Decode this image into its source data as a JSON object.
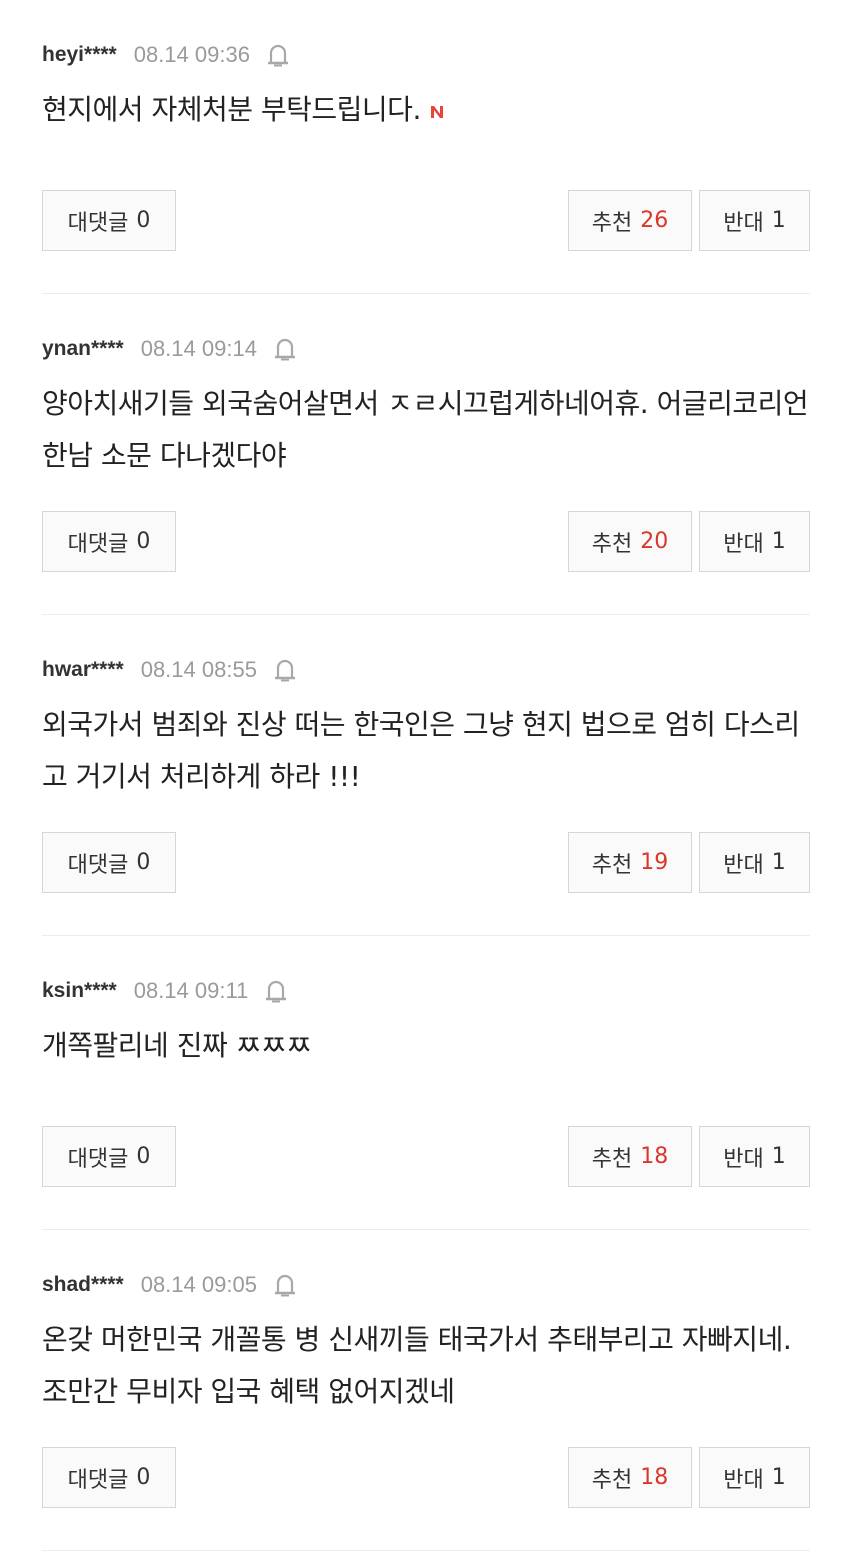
{
  "labels": {
    "reply": "대댓글",
    "recommend": "추천",
    "oppose": "반대"
  },
  "colors": {
    "accent_red": "#d9372b",
    "badge_red": "#e8443a"
  },
  "comments": [
    {
      "user": "heyi****",
      "time": "08.14 09:36",
      "text": "현지에서 자체처분 부탁드립니다.",
      "badge": "N",
      "reply_count": "0",
      "recommend": "26",
      "oppose": "1"
    },
    {
      "user": "ynan****",
      "time": "08.14 09:14",
      "text": "양아치새기들 외국숨어살면서 ㅈㄹ시끄럽게하네어휴. 어글리코리언한남 소문 다나겠다야",
      "reply_count": "0",
      "recommend": "20",
      "oppose": "1"
    },
    {
      "user": "hwar****",
      "time": "08.14 08:55",
      "text": "외국가서 범죄와 진상 떠는 한국인은 그냥 현지 법으로 엄히 다스리고 거기서 처리하게 하라 !!!",
      "reply_count": "0",
      "recommend": "19",
      "oppose": "1"
    },
    {
      "user": "ksin****",
      "time": "08.14 09:11",
      "text": "개쪽팔리네 진짜 ㅉㅉㅉ",
      "reply_count": "0",
      "recommend": "18",
      "oppose": "1"
    },
    {
      "user": "shad****",
      "time": "08.14 09:05",
      "text": "온갖 머한민국 개꼴통 병 신새끼들 태국가서 추태부리고 자빠지네. 조만간 무비자 입국 혜택 없어지겠네",
      "reply_count": "0",
      "recommend": "18",
      "oppose": "1"
    }
  ]
}
